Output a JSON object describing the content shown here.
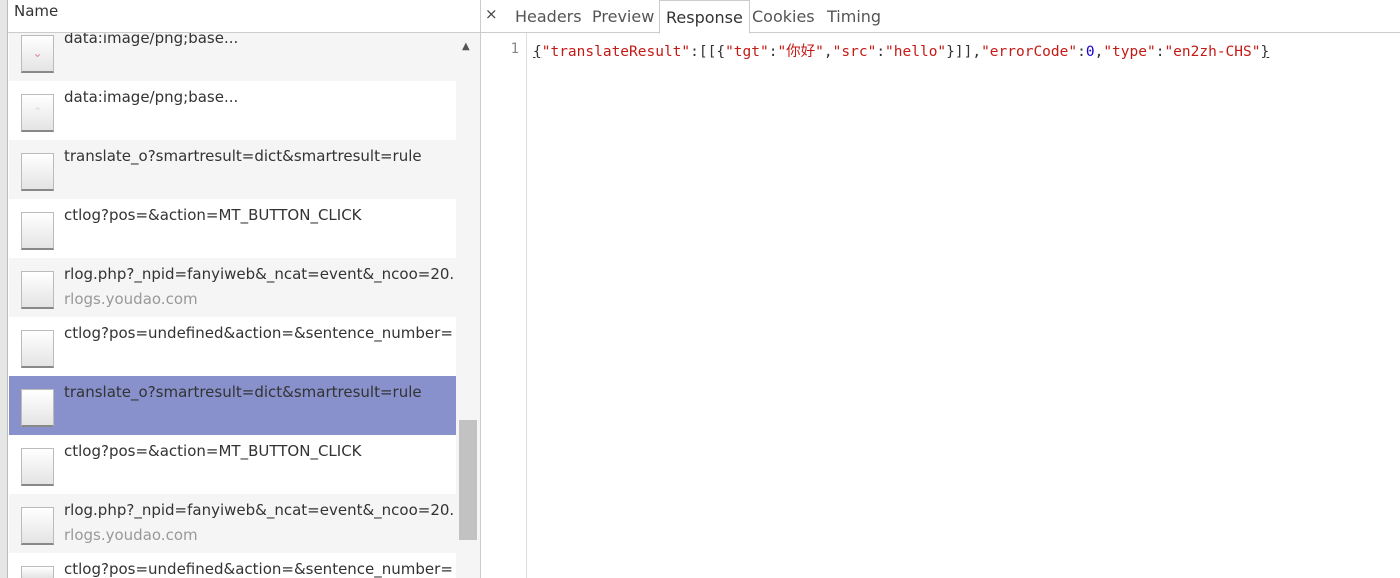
{
  "list": {
    "header": "Name",
    "rows": [
      {
        "name": "data:image/png;base...",
        "sub": "",
        "icon": "chevron-down-icon",
        "style": "alt"
      },
      {
        "name": "data:image/png;base...",
        "sub": "",
        "icon": "chevron-up-icon",
        "style": ""
      },
      {
        "name": "translate_o?smartresult=dict&smartresult=rule",
        "sub": "",
        "icon": "",
        "style": "alt"
      },
      {
        "name": "ctlog?pos=&action=MT_BUTTON_CLICK",
        "sub": "",
        "icon": "",
        "style": ""
      },
      {
        "name": "rlog.php?_npid=fanyiweb&_ncat=event&_ncoo=20.",
        "sub": "rlogs.youdao.com",
        "icon": "",
        "style": "alt"
      },
      {
        "name": "ctlog?pos=undefined&action=&sentence_number=",
        "sub": "",
        "icon": "",
        "style": ""
      },
      {
        "name": "translate_o?smartresult=dict&smartresult=rule",
        "sub": "",
        "icon": "",
        "style": "sel"
      },
      {
        "name": "ctlog?pos=&action=MT_BUTTON_CLICK",
        "sub": "",
        "icon": "",
        "style": ""
      },
      {
        "name": "rlog.php?_npid=fanyiweb&_ncat=event&_ncoo=20.",
        "sub": "rlogs.youdao.com",
        "icon": "",
        "style": "alt"
      },
      {
        "name": "ctlog?pos=undefined&action=&sentence_number=",
        "sub": "",
        "icon": "",
        "style": ""
      }
    ]
  },
  "tabs": {
    "close": "×",
    "items": [
      "Headers",
      "Preview",
      "Response",
      "Cookies",
      "Timing"
    ],
    "active": "Response"
  },
  "response": {
    "line_number": "1",
    "tokens": [
      [
        "{",
        "b"
      ],
      [
        "\"translateResult\"",
        "s"
      ],
      [
        ":[[{",
        ""
      ],
      [
        "\"tgt\"",
        "s"
      ],
      [
        ":",
        ""
      ],
      [
        "\"你好\"",
        "s"
      ],
      [
        ",",
        ""
      ],
      [
        "\"src\"",
        "s"
      ],
      [
        ":",
        ""
      ],
      [
        "\"hello\"",
        "s"
      ],
      [
        "}]],",
        ""
      ],
      [
        "\"errorCode\"",
        "s"
      ],
      [
        ":",
        ""
      ],
      [
        "0",
        "n"
      ],
      [
        ",",
        ""
      ],
      [
        "\"type\"",
        "s"
      ],
      [
        ":",
        ""
      ],
      [
        "\"en2zh-CHS\"",
        "s"
      ],
      [
        "}",
        "b"
      ]
    ]
  }
}
